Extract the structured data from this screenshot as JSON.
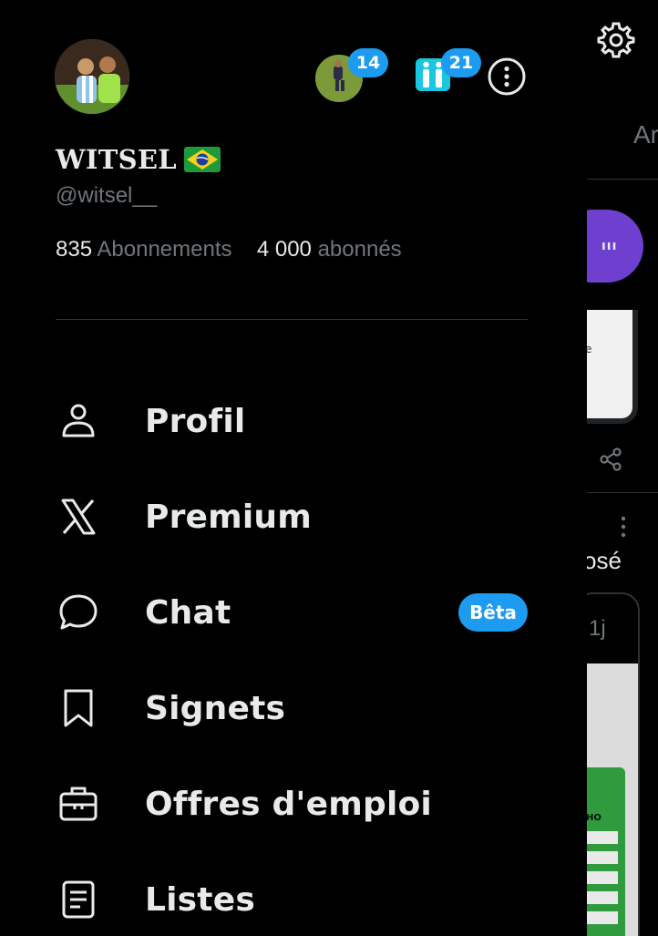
{
  "background": {
    "tab_partial_text": "Ar",
    "post_text_partial": "osé",
    "post_time": "1j",
    "image_text": "HO"
  },
  "account": {
    "display_name": "WITSEL",
    "flag_icon": "brazil-flag-icon",
    "handle": "@witsel__",
    "following_count": "835",
    "following_label": "Abonnements",
    "followers_count": "4 000",
    "followers_label": "abonnés"
  },
  "switcher": {
    "account_1_badge": "14",
    "account_2_badge": "21"
  },
  "menu": {
    "items": [
      {
        "label": "Profil",
        "icon": "person-icon"
      },
      {
        "label": "Premium",
        "icon": "x-logo-icon"
      },
      {
        "label": "Chat",
        "icon": "chat-bubble-icon",
        "badge": "Bêta"
      },
      {
        "label": "Signets",
        "icon": "bookmark-icon"
      },
      {
        "label": "Offres d'emploi",
        "icon": "briefcase-icon"
      },
      {
        "label": "Listes",
        "icon": "list-icon"
      }
    ]
  },
  "colors": {
    "background": "#000000",
    "accent": "#1d9bf0",
    "text": "#e7e9ea",
    "muted": "#71767b",
    "divider": "#2f3336"
  }
}
